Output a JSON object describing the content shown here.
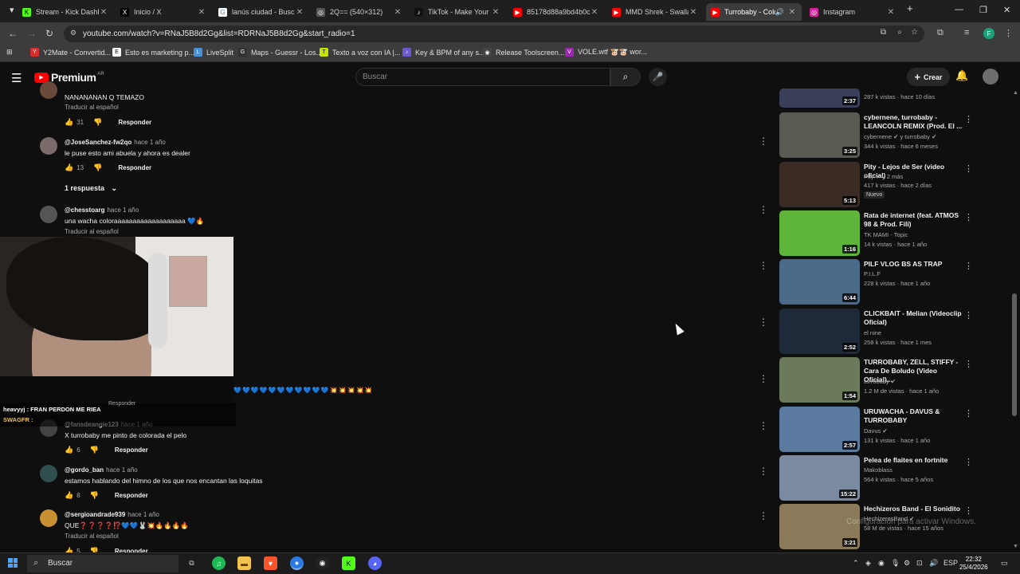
{
  "browser": {
    "tabs": [
      {
        "title": "Stream - Kick Dashboard",
        "color": "#53fc18",
        "glyph": "K"
      },
      {
        "title": "Inicio / X",
        "color": "#000000",
        "glyph": "X"
      },
      {
        "title": "lanús ciudad - Buscar",
        "color": "#ffffff",
        "glyph": "G"
      },
      {
        "title": "2Q== (540×312)",
        "color": "#888888",
        "glyph": "◎"
      },
      {
        "title": "TikTok - Make Your Day",
        "color": "#111111",
        "glyph": "♪"
      },
      {
        "title": "85178d88a9bd4b0c",
        "color": "#ff0000",
        "glyph": "▶"
      },
      {
        "title": "MMD Shrek - Swalla",
        "color": "#ff0000",
        "glyph": "▶"
      },
      {
        "title": "Turrobaby - Colo",
        "color": "#ff0000",
        "glyph": "▶"
      },
      {
        "title": "Instagram",
        "color": "#d6249f",
        "glyph": "◎"
      }
    ],
    "url": "youtube.com/watch?v=RNaJ5B8d2Gg&list=RDRNaJ5B8d2Gg&start_radio=1",
    "bookmarks": [
      {
        "label": "Y2Mate - Convertid...",
        "color": "#d32f2f",
        "glyph": "Y"
      },
      {
        "label": "Esto es marketing p...",
        "color": "#ffffff",
        "glyph": "E"
      },
      {
        "label": "LiveSplit",
        "color": "#4a90d9",
        "glyph": "L"
      },
      {
        "label": "Maps - Guessr - Los...",
        "color": "#333333",
        "glyph": "G"
      },
      {
        "label": "Texto a voz con IA |...",
        "color": "#c8e600",
        "glyph": "T"
      },
      {
        "label": "Key & BPM of any s...",
        "color": "#6a5acd",
        "glyph": "♪"
      },
      {
        "label": "Release Toolscreen...",
        "color": "#444444",
        "glyph": "◉"
      },
      {
        "label": "VOLE.wtf 🐮🐮 wor...",
        "color": "#9c27b0",
        "glyph": "V"
      }
    ]
  },
  "youtube": {
    "brand": "Premium",
    "country": "AR",
    "search_placeholder": "Buscar",
    "create_label": "Crear"
  },
  "comments": [
    {
      "user": "",
      "time": "",
      "text": "NANANANAN Q TEMAZO",
      "translate": "Traducir al español",
      "likes": "31",
      "reply": "Responder",
      "avatar": "#6a4a3a"
    },
    {
      "user": "@JoseSanchez-fw2qo",
      "time": "hace 1 año",
      "text": "le puse esto ami abuela y ahora es dealer",
      "translate": "",
      "likes": "13",
      "reply": "Responder",
      "avatar": "#7a6a6a"
    },
    {
      "user": "@chesstoarg",
      "time": "hace 1 año",
      "text": "una wacha coloraaaaaaaaaaaaaaaaaaa 💙🔥",
      "translate": "Traducir al español",
      "likes": "",
      "reply": "Responder",
      "avatar": "#555555"
    },
    {
      "user": "@fansdeangie123",
      "time": "hace 1 año",
      "text": "X turrobaby me pinto de colorada el pelo",
      "translate": "",
      "likes": "6",
      "reply": "Responder",
      "avatar": "#444444"
    },
    {
      "user": "@gordo_ban",
      "time": "hace 1 año",
      "text": "estamos hablando del himno de los que nos encantan las loquitas",
      "translate": "",
      "likes": "8",
      "reply": "Responder",
      "avatar": "#2f4f4f"
    },
    {
      "user": "@sergioandrade939",
      "time": "hace 1 año",
      "text": "QUE❓❓❓❓⁉️💙💙🐰💥🔥🔥🔥🔥",
      "translate": "Traducir al español",
      "likes": "5",
      "reply": "Responder",
      "avatar": "#c89030"
    }
  ],
  "replies_toggle": "1 respuesta",
  "overlay": {
    "chat_line1": "heavyyj : FRAN PERDON ME RIEA",
    "chat_line2": "SWAGFR :",
    "hidden_reply": "Responder",
    "emoji_row": "💙💙💙💙💙💙💙💙💙💙💙💥💥💥💥💥"
  },
  "recommendations": [
    {
      "title": "",
      "channel": "",
      "meta": "287 k vistas · hace 10 días",
      "duration": "2:37",
      "thumb": "#3a3f5a",
      "badge": ""
    },
    {
      "title": "cybernene, turrobaby - LEANCOLN REMIX (Prod. El ...",
      "channel": "cybernene ✔ y turrobaby ✔",
      "meta": "344 k vistas · hace 6 meses",
      "duration": "3:25",
      "thumb": "#5a5a52",
      "badge": ""
    },
    {
      "title": "Pity - Lejos de Ser (video oficial)",
      "channel": "Pity ✔ y 2 más",
      "meta": "417 k vistas · hace 2 días",
      "duration": "5:13",
      "thumb": "#3b2b25",
      "badge": "Nuevo"
    },
    {
      "title": "Rata de internet (feat. ATMOS 98 & Prod. Fili)",
      "channel": "TK MAMI - Topic",
      "meta": "14 k vistas · hace 1 año",
      "duration": "1:16",
      "thumb": "#5fb53a",
      "badge": ""
    },
    {
      "title": "PILF VLOG BS AS TRAP",
      "channel": "P.I.L.F",
      "meta": "228 k vistas · hace 1 año",
      "duration": "6:44",
      "thumb": "#4a6a8a",
      "badge": ""
    },
    {
      "title": "CLICKBAIT - Melian (Videoclip Oficial)",
      "channel": "el nine",
      "meta": "258 k vistas · hace 1 mes",
      "duration": "2:52",
      "thumb": "#1e2a3a",
      "badge": ""
    },
    {
      "title": "TURROBABY, ZELL, STIFFY - Cara De Boludo (Video Oficial)...",
      "channel": "turrobaby ✔",
      "meta": "1.2 M de vistas · hace 1 año",
      "duration": "1:54",
      "thumb": "#6a7a5a",
      "badge": ""
    },
    {
      "title": "URUWACHA - DAVUS & TURROBABY",
      "channel": "Davus ✔",
      "meta": "131 k vistas · hace 1 año",
      "duration": "2:57",
      "thumb": "#5a7aa0",
      "badge": ""
    },
    {
      "title": "Pelea de flaites en fortnite",
      "channel": "Makoblass",
      "meta": "564 k vistas · hace 5 años",
      "duration": "15:22",
      "thumb": "#7a8aa0",
      "badge": ""
    },
    {
      "title": "Hechizeros Band - El Sonidito",
      "channel": "HechizerosBand ✔",
      "meta": "58 M de vistas · hace 15 años",
      "duration": "3:21",
      "thumb": "#8a7a5a",
      "badge": ""
    }
  ],
  "watermark": "Configuración para activar Windows.",
  "taskbar": {
    "search_label": "Buscar",
    "lang": "ESP",
    "time": "22:32",
    "date": "25/4/2026"
  }
}
